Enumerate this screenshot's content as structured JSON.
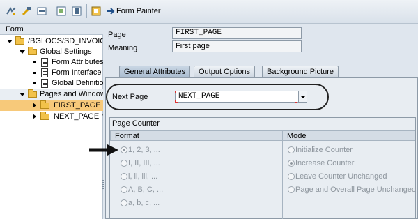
{
  "toolbar": {
    "title_label": "Form Painter",
    "icons": [
      "other-object-icon",
      "display-change-icon",
      "activate-icon",
      "page-window-icon",
      "graphic-icon",
      "test-icon",
      "form-painter-icon"
    ]
  },
  "tree": {
    "header": "Form",
    "items": [
      {
        "label": "/BGLOCS/SD_INVOICE",
        "type": "folder",
        "expanded": true
      },
      {
        "label": "Global Settings",
        "type": "folder",
        "expanded": true
      },
      {
        "label": "Form Attributes",
        "type": "doc"
      },
      {
        "label": "Form Interface",
        "type": "doc"
      },
      {
        "label": "Global Definitions",
        "type": "doc"
      },
      {
        "label": "Pages and Windows",
        "type": "folder",
        "expanded": true
      },
      {
        "label": "FIRST_PAGE First page",
        "type": "folder",
        "selected": true
      },
      {
        "label": "NEXT_PAGE next page",
        "type": "folder"
      }
    ]
  },
  "fields": {
    "page_label": "Page",
    "page_value": "FIRST_PAGE",
    "meaning_label": "Meaning",
    "meaning_value": "First page"
  },
  "tabs": [
    {
      "label": "General Attributes",
      "active": true
    },
    {
      "label": "Output Options",
      "active": false
    },
    {
      "label": "Background Picture",
      "active": false
    }
  ],
  "next_page": {
    "label": "Next Page",
    "value": "NEXT_PAGE"
  },
  "page_counter": {
    "title": "Page Counter",
    "format_header": "Format",
    "mode_header": "Mode",
    "formats": [
      {
        "label": "1, 2, 3, ...",
        "selected": true
      },
      {
        "label": "I, II, III, ...",
        "selected": false
      },
      {
        "label": "i, ii, iii, ...",
        "selected": false
      },
      {
        "label": "A, B, C, ...",
        "selected": false
      },
      {
        "label": "a, b, c, ...",
        "selected": false
      }
    ],
    "modes": [
      {
        "label": "Initialize Counter",
        "selected": false
      },
      {
        "label": "Increase Counter",
        "selected": true
      },
      {
        "label": "Leave Counter Unchanged",
        "selected": false
      },
      {
        "label": "Page and Overall Page Unchanged",
        "selected": false
      }
    ]
  },
  "colors": {
    "selected_tree_row": "#f7c97a",
    "background": "#dfe6ee",
    "highlight_oval": "#222222"
  }
}
